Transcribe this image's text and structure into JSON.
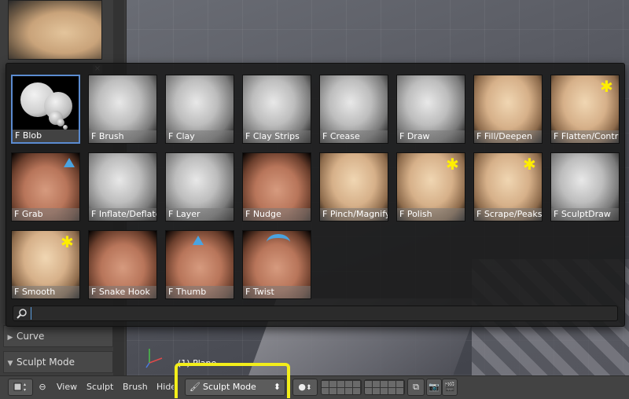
{
  "brush_popup": {
    "search_placeholder": "",
    "close_glyph": "×",
    "brushes": [
      {
        "label": "F Blob",
        "style": "grey-blob",
        "active": true
      },
      {
        "label": "F Brush",
        "style": "grey"
      },
      {
        "label": "F Clay",
        "style": "grey"
      },
      {
        "label": "F Clay Strips",
        "style": "grey"
      },
      {
        "label": "F Crease",
        "style": "grey"
      },
      {
        "label": "F Draw",
        "style": "grey"
      },
      {
        "label": "F Fill/Deepen",
        "style": "tan"
      },
      {
        "label": "F Flatten/Contras",
        "style": "tan"
      },
      {
        "label": "F Grab",
        "style": "clay"
      },
      {
        "label": "F Inflate/Deflate",
        "style": "grey"
      },
      {
        "label": "F Layer",
        "style": "grey"
      },
      {
        "label": "F Nudge",
        "style": "clay"
      },
      {
        "label": "F Pinch/Magnify",
        "style": "tan"
      },
      {
        "label": "F Polish",
        "style": "tan"
      },
      {
        "label": "F Scrape/Peaks",
        "style": "tan"
      },
      {
        "label": "F SculptDraw",
        "style": "grey"
      },
      {
        "label": "F Smooth",
        "style": "tan"
      },
      {
        "label": "F Snake Hook",
        "style": "clay"
      },
      {
        "label": "F Thumb",
        "style": "clay"
      },
      {
        "label": "F Twist",
        "style": "clay"
      }
    ]
  },
  "left_panel": {
    "sections": [
      {
        "label": "Curve",
        "expanded": false
      },
      {
        "label": "Sculpt Mode",
        "expanded": true
      }
    ]
  },
  "viewport": {
    "object_label": "(1) Plane"
  },
  "header": {
    "menu_view": "View",
    "menu_sculpt": "Sculpt",
    "menu_brush": "Brush",
    "menu_hide": "Hide",
    "mode_value": "Sculpt Mode",
    "spinner_glyph": "⬍"
  },
  "colors": {
    "highlight": "#f3ee1a",
    "active_border": "#5b8bd0",
    "accent_blue": "#4aa3e0"
  }
}
